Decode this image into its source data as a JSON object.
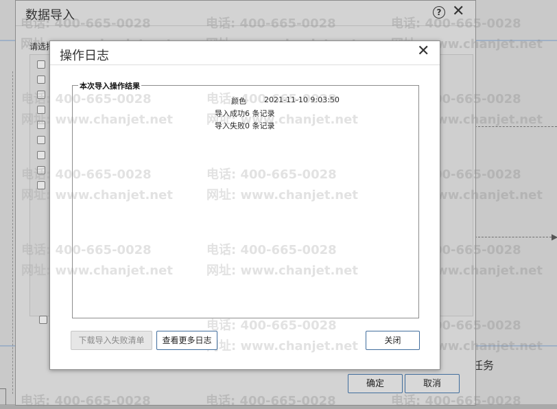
{
  "outer_dialog": {
    "title": "数据导入",
    "help_icon": "?",
    "close_icon": "✕",
    "select_label": "请选择",
    "confirm_label": "确定",
    "cancel_label": "取消"
  },
  "background": {
    "task_label": "任务"
  },
  "watermark": {
    "phone": "电话: 400-665-0028",
    "site": "网址: www.chanjet.net"
  },
  "log_dialog": {
    "title": "操作日志",
    "close_icon": "✕",
    "group_title": "本次导入操作结果",
    "entries": [
      {
        "name": "颜色",
        "time": "2021-11-10 9:03:50"
      }
    ],
    "success_text": "导入成功6 条记录",
    "fail_text": "导入失败0 条记录",
    "download_failed_label": "下载导入失败清单",
    "more_logs_label": "查看更多日志",
    "close_label": "关闭"
  }
}
